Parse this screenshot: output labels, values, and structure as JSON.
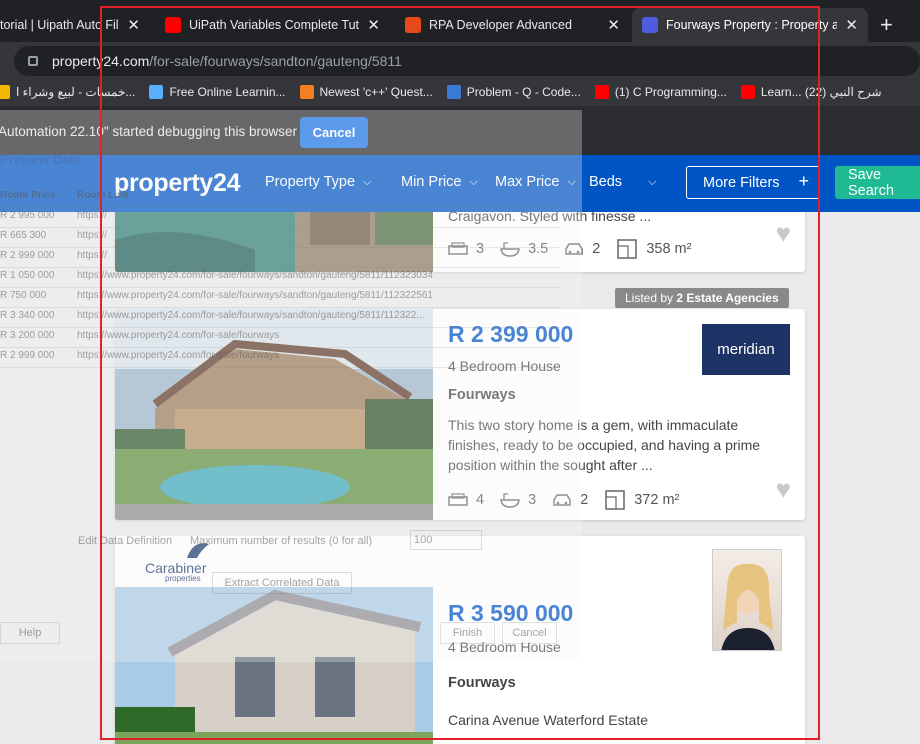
{
  "browser": {
    "tabs": [
      {
        "title": "torial | Uipath Auto Fill",
        "close": "✕",
        "favicon_color": "#202124"
      },
      {
        "title": "UiPath Variables Complete Tutori",
        "close": "✕",
        "favicon_color": "#ff0000"
      },
      {
        "title": "RPA Developer Advanced",
        "close": "✕",
        "favicon_color": "#e64a19"
      },
      {
        "title": "Fourways Property : Property and",
        "close": "✕",
        "favicon_color": "#4e5de0"
      }
    ],
    "new_tab": "+",
    "address": {
      "host": "property24.com",
      "path": "/for-sale/fourways/sandton/gauteng/5811"
    },
    "bookmarks": [
      {
        "label": "خمسات - لبيع وشراء ا...",
        "icon_color": "#f2b900"
      },
      {
        "label": "Free Online Learnin...",
        "icon_color": "#5ab0ff"
      },
      {
        "label": "Newest 'c++' Quest...",
        "icon_color": "#f48024"
      },
      {
        "label": "Problem - Q - Code...",
        "icon_color": "#3b79d6"
      },
      {
        "label": "(1) C Programming...",
        "icon_color": "#ff0000"
      },
      {
        "label": "Learn... شرح النبي (22)",
        "icon_color": "#ff0000"
      }
    ],
    "infobar": {
      "text": "Automation 22.10\" started debugging this browser",
      "cancel": "Cancel"
    }
  },
  "site": {
    "logo": "property24",
    "nav": [
      "Property Type",
      "Min Price",
      "Max Price",
      "Beds"
    ],
    "more_filters": "More Filters",
    "save_search": "Save Search"
  },
  "listings": [
    {
      "desc_partial": "Craigavon. Styled with finesse ...",
      "beds": "3",
      "baths": "3.5",
      "garages": "2",
      "size": "358 m²"
    },
    {
      "agency_badge_prefix": "Listed by ",
      "agency_badge_bold": "2 Estate Agencies",
      "agency_logo": "meridian",
      "price": "R 2 399 000",
      "type": "4 Bedroom House",
      "suburb": "Fourways",
      "description": "This two story home is a gem, with immaculate finishes, ready to be occupied, and having a prime position within the sought after ...",
      "beds": "4",
      "baths": "3",
      "garages": "2",
      "size": "372 m²"
    },
    {
      "agency_logo": "Carabiner",
      "agency_logo_sub": "properties",
      "price": "R 3 590 000",
      "type": "4 Bedroom House",
      "suburb": "Fourways",
      "address": "Carina Avenue Waterford Estate"
    }
  ],
  "overlay": {
    "title": "Preview Data",
    "col1": "Room Price",
    "col2": "Room Link",
    "rows": [
      {
        "price": "R 2 995 000",
        "link": "https://"
      },
      {
        "price": "R 665 300",
        "link": "https://"
      },
      {
        "price": "R 2 999 000",
        "link": "https://"
      },
      {
        "price": "R 1 050 000",
        "link": "https://www.property24.com/for-sale/fourways/sandton/gauteng/5811/112323034"
      },
      {
        "price": "R 750 000",
        "link": "https://www.property24.com/for-sale/fourways/sandton/gauteng/5811/112322561"
      },
      {
        "price": "R 3 340 000",
        "link": "https://www.property24.com/for-sale/fourways/sandton/gauteng/5811/112322..."
      },
      {
        "price": "R 3 200 000",
        "link": "https://www.property24.com/for-sale/fourways"
      },
      {
        "price": "R 2 999 000",
        "link": "https://www.property24.com/for-sale/fourways"
      }
    ],
    "extract_label": "Edit Data Definition",
    "max_label": "Maximum number of results (0 for all)",
    "max_value": "100",
    "extract_btn": "Extract Correlated Data",
    "help": "Help",
    "finish": "Finish",
    "cancel": "Cancel"
  }
}
